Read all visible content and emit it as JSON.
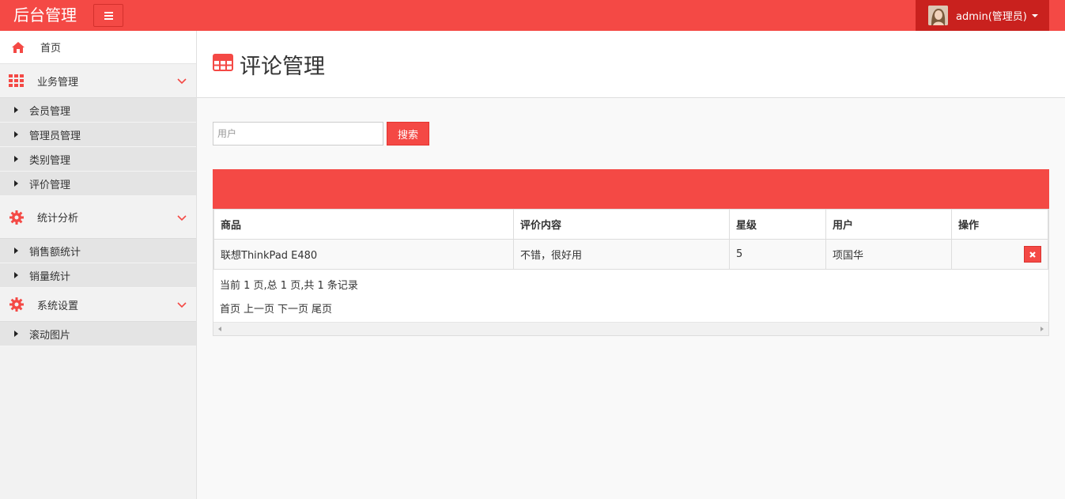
{
  "topbar": {
    "brand": "后台管理",
    "user_label": "admin(管理员)",
    "icons": {
      "menu": "hamburger-icon",
      "avatar": "user-avatar",
      "caret": "caret-down-icon"
    }
  },
  "sidebar": {
    "home": {
      "label": "首页",
      "icon": "home-icon"
    },
    "groups": [
      {
        "label": "业务管理",
        "icon": "grid-icon",
        "items": [
          "会员管理",
          "管理员管理",
          "类别管理",
          "评价管理"
        ]
      },
      {
        "label": "统计分析",
        "icon": "gear-icon",
        "items": [
          "销售额统计",
          "销量统计"
        ]
      },
      {
        "label": "系统设置",
        "icon": "gear-icon",
        "items": [
          "滚动图片"
        ]
      }
    ]
  },
  "page": {
    "title": "评论管理",
    "title_icon": "table-icon"
  },
  "search": {
    "placeholder": "用户",
    "value": "",
    "button_label": "搜索"
  },
  "table": {
    "headers": [
      "商品",
      "评价内容",
      "星级",
      "用户",
      "操作"
    ],
    "rows": [
      {
        "product": "联想ThinkPad E480",
        "comment": "不错，很好用",
        "stars": "5",
        "user": "项国华",
        "action_icon": "delete-icon"
      }
    ]
  },
  "pager": {
    "info": "当前 1 页,总 1 页,共 1 条记录",
    "first": "首页",
    "prev": "上一页",
    "next": "下一页",
    "last": "尾页"
  },
  "colors": {
    "brand_red": "#f44945",
    "user_box_red": "#c9211e"
  }
}
